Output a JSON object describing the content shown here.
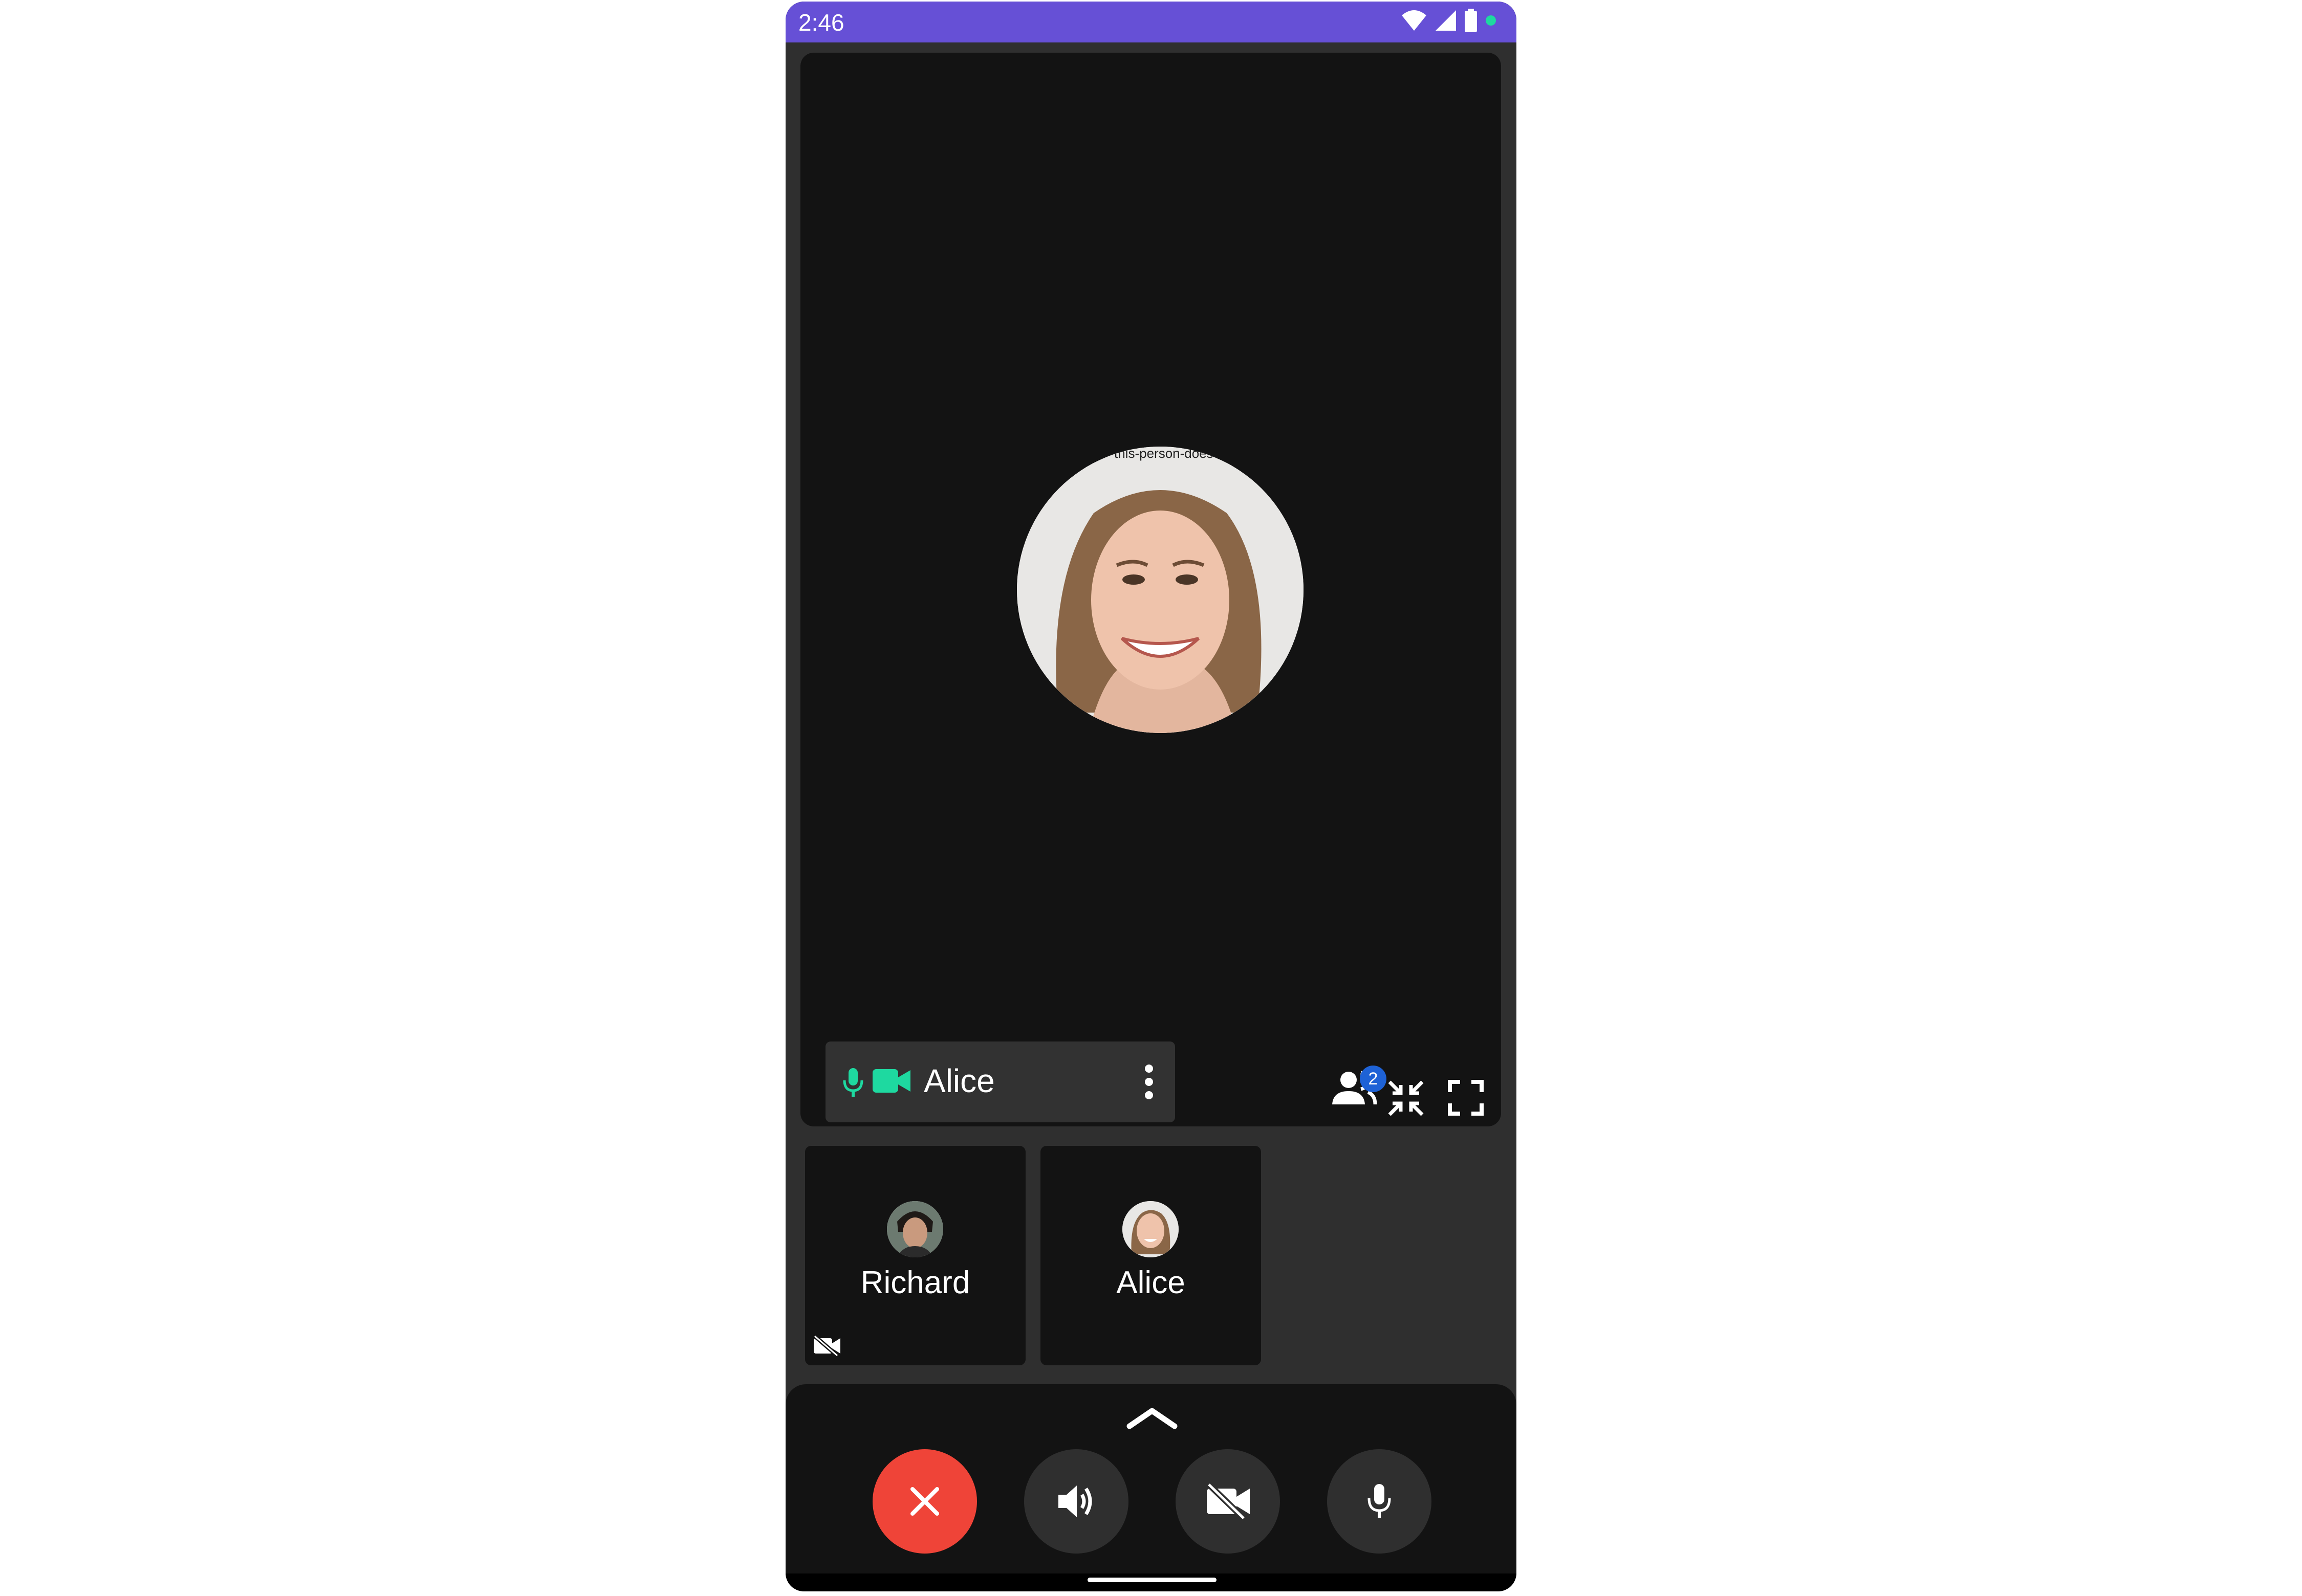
{
  "status_bar": {
    "time": "2:46"
  },
  "main_tile": {
    "participant_name": "Alice",
    "avatar_watermark": "this-person-does",
    "participants_count": "2"
  },
  "thumbnails": [
    {
      "name": "Richard",
      "video_off": true
    },
    {
      "name": "Alice",
      "video_off": false
    }
  ],
  "icons": {
    "status": [
      "wifi-icon",
      "cell-signal-icon",
      "battery-icon",
      "privacy-dot-icon"
    ],
    "name_bar": [
      "mic-icon",
      "camera-icon",
      "more-vert-icon"
    ],
    "tile_tools": [
      "participants-icon",
      "exit-fullscreen-icon",
      "fullscreen-icon"
    ],
    "controls": [
      "chevron-up-icon",
      "end-call-icon",
      "speaker-icon",
      "video-off-icon",
      "mic-icon"
    ]
  },
  "colors": {
    "status_bar": "#6650d6",
    "accent_green": "#1ed9a0",
    "end_call": "#ef4438",
    "badge_blue": "#1e62d6",
    "tile_bg": "#131313",
    "screen_bg": "#2f2f2f"
  }
}
